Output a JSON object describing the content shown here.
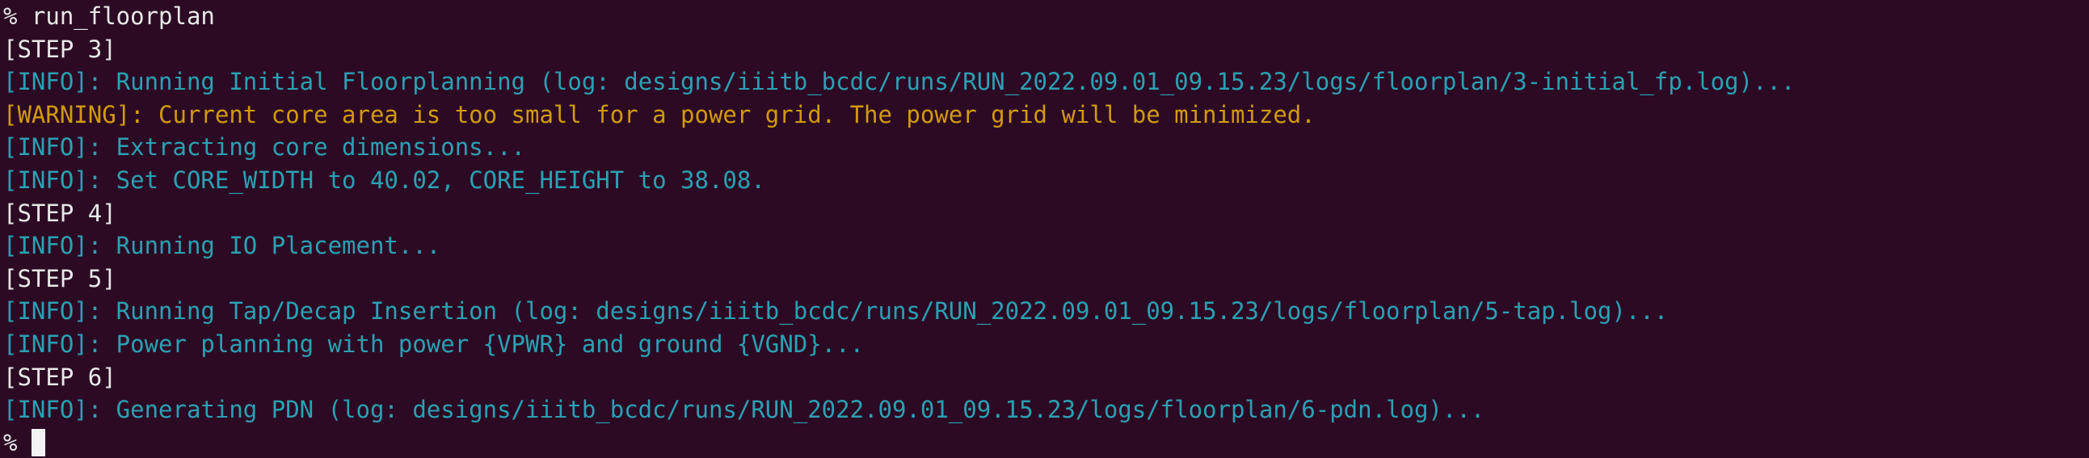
{
  "terminal": {
    "lines": [
      {
        "text": "% run_floorplan",
        "kind": "white"
      },
      {
        "text": "[STEP 3]",
        "kind": "white"
      },
      {
        "text": "[INFO]: Running Initial Floorplanning (log: designs/iiitb_bcdc/runs/RUN_2022.09.01_09.15.23/logs/floorplan/3-initial_fp.log)...",
        "kind": "cyan"
      },
      {
        "text": "[WARNING]: Current core area is too small for a power grid. The power grid will be minimized.",
        "kind": "warn"
      },
      {
        "text": "[INFO]: Extracting core dimensions...",
        "kind": "cyan"
      },
      {
        "text": "[INFO]: Set CORE_WIDTH to 40.02, CORE_HEIGHT to 38.08.",
        "kind": "cyan"
      },
      {
        "text": "[STEP 4]",
        "kind": "white"
      },
      {
        "text": "[INFO]: Running IO Placement...",
        "kind": "cyan"
      },
      {
        "text": "[STEP 5]",
        "kind": "white"
      },
      {
        "text": "[INFO]: Running Tap/Decap Insertion (log: designs/iiitb_bcdc/runs/RUN_2022.09.01_09.15.23/logs/floorplan/5-tap.log)...",
        "kind": "cyan"
      },
      {
        "text": "[INFO]: Power planning with power {VPWR} and ground {VGND}...",
        "kind": "cyan"
      },
      {
        "text": "[STEP 6]",
        "kind": "white"
      },
      {
        "text": "[INFO]: Generating PDN (log: designs/iiitb_bcdc/runs/RUN_2022.09.01_09.15.23/logs/floorplan/6-pdn.log)...",
        "kind": "cyan"
      }
    ],
    "prompt": "% "
  },
  "colors": {
    "background": "#2c0a24",
    "info": "#2aa1b3",
    "warning": "#d19a0c",
    "default": "#e8e8e8",
    "cursor": "#f2f2f2"
  }
}
